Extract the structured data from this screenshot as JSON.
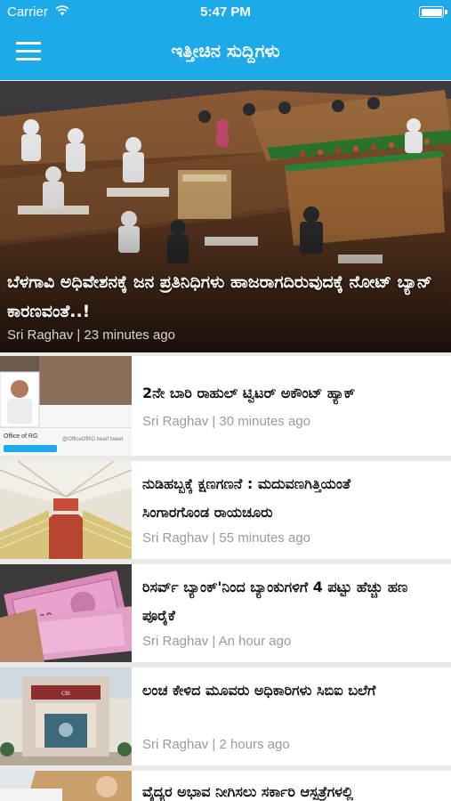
{
  "status_bar": {
    "carrier": "Carrier",
    "time": "5:47 PM"
  },
  "header": {
    "title": "ಇತ್ತೀಚಿನ ಸುದ್ದಿಗಳು",
    "menu_icon": "hamburger-menu-icon"
  },
  "colors": {
    "accent": "#1ea9e8",
    "meta_text": "#9a9a9a"
  },
  "featured": {
    "title": "ಬೆಳಗಾವಿ ಅಧಿವೇಶನಕ್ಕೆ ಜನ ಪ್ರತಿನಿಧಿಗಳು ಹಾಜರಾಗದಿರುವುದಕ್ಕೆ ನೋಟ್ ಬ್ಯಾನ್ ಕಾರಣವಂತೆ..!",
    "meta": "Sri Raghav | 23 minutes ago"
  },
  "articles": [
    {
      "title": "2ನೇ ಬಾರಿ ರಾಹುಲ್ ಟ್ವಿಟರ್ ಅಕೌಂಟ್ ಹ್ಯಾಕ್",
      "meta": "Sri Raghav | 30 minutes ago"
    },
    {
      "title": "ನುಡಿಹಬ್ಬಕ್ಕೆ ಕ್ಷಣಗಣನೆ : ಮದುವಣಗಿತ್ತಿಯಂತೆ ಸಿಂಗಾರಗೊಂಡ ರಾಯಚೂರು",
      "meta": "Sri Raghav | 55 minutes ago"
    },
    {
      "title": "ರಿಸರ್ವ್ ಬ್ಯಾಂಕ್'ನಿಂದ ಬ್ಯಾಂಕುಗಳಿಗೆ 4 ಪಟ್ಟು ಹೆಚ್ಚು ಹಣ ಪೂರೈಕೆ",
      "meta": "Sri Raghav | An hour ago"
    },
    {
      "title": "ಲಂಚ ಕೇಳಿದ ಮೂವರು ಅಧಿಕಾರಿಗಳು ಸಿಬಿಐ ಬಲೆಗೆ",
      "meta": "Sri Raghav | 2 hours ago"
    },
    {
      "title": "ವೈದ್ಯರ ಅಭಾವ ನೀಗಿಸಲು ಸರ್ಕಾರಿ ಆಸ್ಪತ್ರೆಗಳಲ್ಲಿ",
      "meta": ""
    }
  ]
}
